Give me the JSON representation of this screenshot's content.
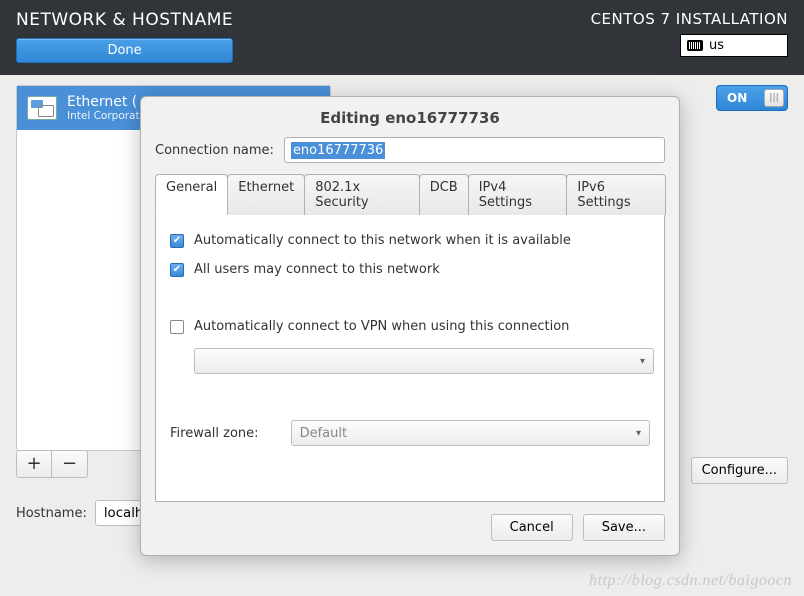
{
  "header": {
    "title": "NETWORK & HOSTNAME",
    "subtitle": "CENTOS 7 INSTALLATION",
    "done_label": "Done",
    "keyboard_layout": "us"
  },
  "device": {
    "name": "Ethernet (",
    "sub": "Intel Corporat"
  },
  "toggle": {
    "label": "ON"
  },
  "buttons": {
    "add": "+",
    "remove": "−",
    "configure": "Configure..."
  },
  "hostname": {
    "label": "Hostname:",
    "value": "localh"
  },
  "dialog": {
    "title": "Editing eno16777736",
    "conn_name_label": "Connection name:",
    "conn_name_value": "eno16777736",
    "tabs": [
      "General",
      "Ethernet",
      "802.1x Security",
      "DCB",
      "IPv4 Settings",
      "IPv6 Settings"
    ],
    "checks": {
      "auto_connect": "Automatically connect to this network when it is available",
      "all_users": "All users may connect to this network",
      "auto_vpn": "Automatically connect to VPN when using this connection"
    },
    "firewall_label": "Firewall zone:",
    "firewall_value": "Default",
    "cancel": "Cancel",
    "save": "Save..."
  },
  "watermark": "http://blog.csdn.net/baigoocn"
}
